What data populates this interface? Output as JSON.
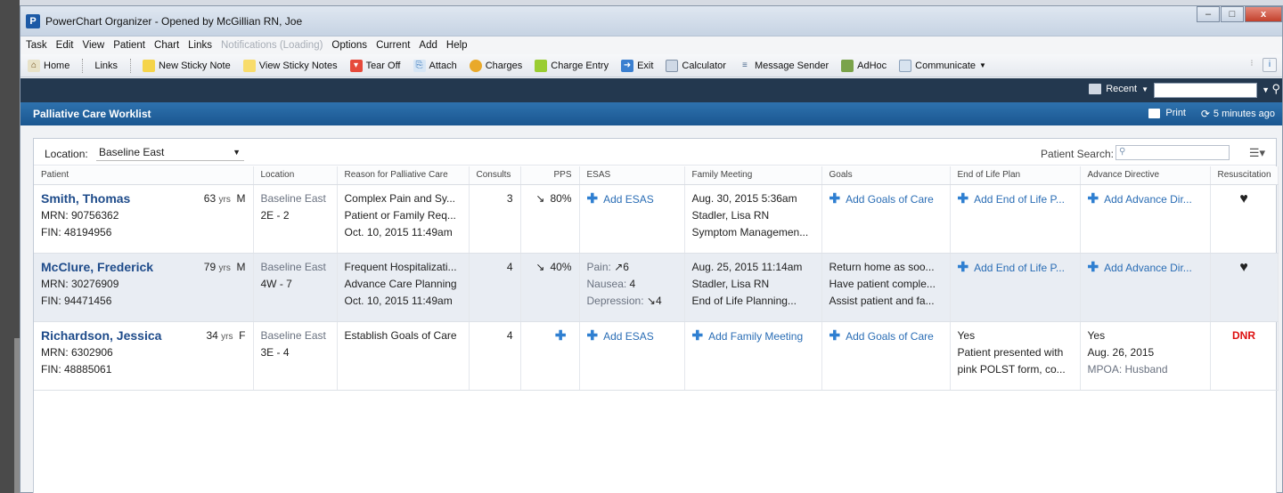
{
  "window": {
    "title": "PowerChart Organizer - Opened by McGillian RN, Joe",
    "app_icon_letter": "P",
    "controls": {
      "minimize": "–",
      "maximize": "□",
      "close": "x"
    }
  },
  "menu": [
    {
      "label": "Task",
      "disabled": false
    },
    {
      "label": "Edit",
      "disabled": false
    },
    {
      "label": "View",
      "disabled": false
    },
    {
      "label": "Patient",
      "disabled": false
    },
    {
      "label": "Chart",
      "disabled": false
    },
    {
      "label": "Links",
      "disabled": false
    },
    {
      "label": "Notifications (Loading)",
      "disabled": true
    },
    {
      "label": "Options",
      "disabled": false
    },
    {
      "label": "Current",
      "disabled": false
    },
    {
      "label": "Add",
      "disabled": false
    },
    {
      "label": "Help",
      "disabled": false
    }
  ],
  "toolbar": {
    "home": "Home",
    "links": "Links",
    "new_sticky": "New Sticky Note",
    "view_sticky": "View Sticky Notes",
    "tear_off": "Tear Off",
    "attach": "Attach",
    "charges": "Charges",
    "charge_entry": "Charge Entry",
    "exit": "Exit",
    "calculator": "Calculator",
    "message_sender": "Message Sender",
    "adhoc": "AdHoc",
    "communicate": "Communicate"
  },
  "topbar": {
    "recent": "Recent"
  },
  "worklist": {
    "title": "Palliative Care Worklist",
    "print": "Print",
    "refresh": "5 minutes ago"
  },
  "filters": {
    "location_label": "Location:",
    "location_value": "Baseline East",
    "patient_search_label": "Patient Search:"
  },
  "columns": {
    "patient": "Patient",
    "location": "Location",
    "reason": "Reason for Palliative Care",
    "consults": "Consults",
    "pps": "PPS",
    "esas": "ESAS",
    "family": "Family Meeting",
    "goals": "Goals",
    "eol": "End of Life Plan",
    "advance": "Advance Directive",
    "resus": "Resuscitation"
  },
  "rows": [
    {
      "name": "Smith, Thomas",
      "age": "63",
      "age_unit": "yrs",
      "sex": "M",
      "mrn": "MRN: 90756362",
      "fin": "FIN: 48194956",
      "loc_unit": "Baseline East",
      "loc_room": "2E - 2",
      "reason1": "Complex Pain and Sy...",
      "reason2": "Patient or Family Req...",
      "reason3": "Oct. 10, 2015 11:49am",
      "consults": "3",
      "pps": "80%",
      "esas": "Add ESAS",
      "family1": "Aug. 30, 2015 5:36am",
      "family2": "Stadler, Lisa RN",
      "family3": "Symptom Managemen...",
      "goals": "Add Goals of Care",
      "eol": "Add End of Life P...",
      "advance": "Add Advance Dir..."
    },
    {
      "name": "McClure, Frederick",
      "age": "79",
      "age_unit": "yrs",
      "sex": "M",
      "mrn": "MRN: 30276909",
      "fin": "FIN: 94471456",
      "loc_unit": "Baseline East",
      "loc_room": "4W - 7",
      "reason1": "Frequent Hospitalizati...",
      "reason2": "Advance Care Planning",
      "reason3": "Oct. 10, 2015 11:49am",
      "consults": "4",
      "pps": "40%",
      "esas_pain_label": "Pain:",
      "esas_pain_value": "6",
      "esas_nausea_label": "Nausea:",
      "esas_nausea_value": "4",
      "esas_depression_label": "Depression:",
      "esas_depression_value": "4",
      "family1": "Aug. 25, 2015 11:14am",
      "family2": "Stadler, Lisa RN",
      "family3": "End of Life Planning...",
      "goals1": "Return home as soo...",
      "goals2": "Have patient comple...",
      "goals3": "Assist patient and fa...",
      "eol": "Add End of Life P...",
      "advance": "Add Advance Dir..."
    },
    {
      "name": "Richardson, Jessica",
      "age": "34",
      "age_unit": "yrs",
      "sex": "F",
      "mrn": "MRN: 6302906",
      "fin": "FIN: 48885061",
      "loc_unit": "Baseline East",
      "loc_room": "3E - 4",
      "reason1": "Establish Goals of Care",
      "consults": "4",
      "esas": "Add ESAS",
      "family": "Add Family Meeting",
      "goals": "Add Goals of Care",
      "eol1": "Yes",
      "eol2": "Patient presented with",
      "eol3": "pink POLST form, co...",
      "adv1": "Yes",
      "adv2": "Aug. 26, 2015",
      "adv3": "MPOA: Husband",
      "resus": "DNR"
    }
  ]
}
